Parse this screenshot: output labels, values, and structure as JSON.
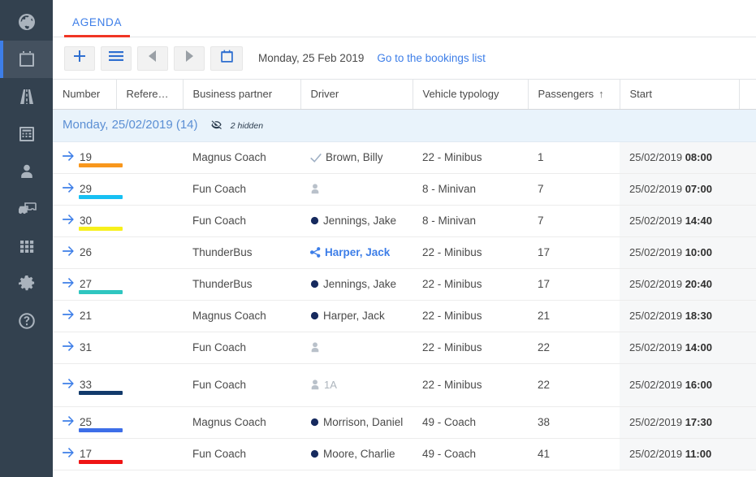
{
  "sidebar": {
    "items": [
      {
        "name": "globe",
        "icon": "globe-icon",
        "active": false
      },
      {
        "name": "agenda",
        "icon": "calendar-icon",
        "active": true
      },
      {
        "name": "routes",
        "icon": "road-icon",
        "active": false
      },
      {
        "name": "accounting",
        "icon": "calculator-icon",
        "active": false
      },
      {
        "name": "contacts",
        "icon": "person-icon",
        "active": false
      },
      {
        "name": "fleet",
        "icon": "vehicles-icon",
        "active": false
      },
      {
        "name": "apps",
        "icon": "grid-icon",
        "active": false
      },
      {
        "name": "settings",
        "icon": "gear-icon",
        "active": false
      },
      {
        "name": "help",
        "icon": "question-icon",
        "active": false
      }
    ]
  },
  "tabs": [
    {
      "label": "AGENDA",
      "active": true
    }
  ],
  "toolbar": {
    "add_label": "+",
    "menu_icon": "hamburger-icon",
    "prev_icon": "triangle-left-icon",
    "next_icon": "triangle-right-icon",
    "calendar_icon": "calendar-icon",
    "date_label": "Monday, 25 Feb 2019",
    "bookings_link": "Go to the bookings list"
  },
  "table": {
    "columns": [
      {
        "label": "Number",
        "sorted": false
      },
      {
        "label": "Refere…",
        "sorted": false
      },
      {
        "label": "Business partner",
        "sorted": false
      },
      {
        "label": "Driver",
        "sorted": false
      },
      {
        "label": "Vehicle typology",
        "sorted": false
      },
      {
        "label": "Passengers",
        "sorted": true,
        "sort_arrow": "↑"
      },
      {
        "label": "Start",
        "sorted": false
      },
      {
        "label": "",
        "sorted": false
      }
    ],
    "group": {
      "title": "Monday, 25/02/2019 (14)",
      "hidden_label": "2 hidden",
      "hidden_icon": "eye-slash-icon"
    },
    "rows": [
      {
        "number": "19",
        "color": "#f8971d",
        "reference": "",
        "business_partner": "Magnus Coach",
        "driver_name": "Brown, Billy",
        "driver_icon": "check-icon",
        "driver_badge": "",
        "driver_linked": false,
        "vehicle": "22 - Minibus",
        "passengers": "1",
        "start_date": "25/02/2019",
        "start_time": "08:00",
        "tall": false
      },
      {
        "number": "29",
        "color": "#17c0f3",
        "reference": "",
        "business_partner": "Fun Coach",
        "driver_name": "",
        "driver_icon": "person-icon",
        "driver_badge": "",
        "driver_linked": false,
        "vehicle": "8 - Minivan",
        "passengers": "7",
        "start_date": "25/02/2019",
        "start_time": "07:00",
        "tall": false
      },
      {
        "number": "30",
        "color": "#f7f01c",
        "reference": "",
        "business_partner": "Fun Coach",
        "driver_name": "Jennings, Jake",
        "driver_icon": "dot-icon",
        "driver_badge": "",
        "driver_linked": false,
        "vehicle": "8 - Minivan",
        "passengers": "7",
        "start_date": "25/02/2019",
        "start_time": "14:40",
        "tall": false
      },
      {
        "number": "26",
        "color": "",
        "reference": "",
        "business_partner": "ThunderBus",
        "driver_name": "Harper, Jack",
        "driver_icon": "share-icon",
        "driver_badge": "",
        "driver_linked": true,
        "vehicle": "22 - Minibus",
        "passengers": "17",
        "start_date": "25/02/2019",
        "start_time": "10:00",
        "tall": false
      },
      {
        "number": "27",
        "color": "#2fc6c0",
        "reference": "",
        "business_partner": "ThunderBus",
        "driver_name": "Jennings, Jake",
        "driver_icon": "dot-icon",
        "driver_badge": "",
        "driver_linked": false,
        "vehicle": "22 - Minibus",
        "passengers": "17",
        "start_date": "25/02/2019",
        "start_time": "20:40",
        "tall": false
      },
      {
        "number": "21",
        "color": "",
        "reference": "",
        "business_partner": "Magnus Coach",
        "driver_name": "Harper, Jack",
        "driver_icon": "dot-icon",
        "driver_badge": "",
        "driver_linked": false,
        "vehicle": "22 - Minibus",
        "passengers": "21",
        "start_date": "25/02/2019",
        "start_time": "18:30",
        "tall": false
      },
      {
        "number": "31",
        "color": "",
        "reference": "",
        "business_partner": "Fun Coach",
        "driver_name": "",
        "driver_icon": "person-icon",
        "driver_badge": "",
        "driver_linked": false,
        "vehicle": "22 - Minibus",
        "passengers": "22",
        "start_date": "25/02/2019",
        "start_time": "14:00",
        "tall": false
      },
      {
        "number": "33",
        "color": "#123a6b",
        "reference": "",
        "business_partner": "Fun Coach",
        "driver_name": "",
        "driver_icon": "person-icon",
        "driver_badge": "1A",
        "driver_linked": false,
        "vehicle": "22 - Minibus",
        "passengers": "22",
        "start_date": "25/02/2019",
        "start_time": "16:00",
        "tall": true
      },
      {
        "number": "25",
        "color": "#3d6ee8",
        "reference": "",
        "business_partner": "Magnus Coach",
        "driver_name": "Morrison, Daniel",
        "driver_icon": "dot-icon",
        "driver_badge": "",
        "driver_linked": false,
        "vehicle": "49 - Coach",
        "passengers": "38",
        "start_date": "25/02/2019",
        "start_time": "17:30",
        "tall": false
      },
      {
        "number": "17",
        "color": "#ef1414",
        "reference": "",
        "business_partner": "Fun Coach",
        "driver_name": "Moore, Charlie",
        "driver_icon": "dot-icon",
        "driver_badge": "",
        "driver_linked": false,
        "vehicle": "49 - Coach",
        "passengers": "41",
        "start_date": "25/02/2019",
        "start_time": "11:00",
        "tall": false
      }
    ]
  },
  "colors": {
    "sidebar_bg": "#33414f",
    "sidebar_active": "#44515f",
    "accent_blue": "#3d7ee8",
    "tab_underline": "#f03524",
    "group_bg": "#e9f3fb"
  }
}
